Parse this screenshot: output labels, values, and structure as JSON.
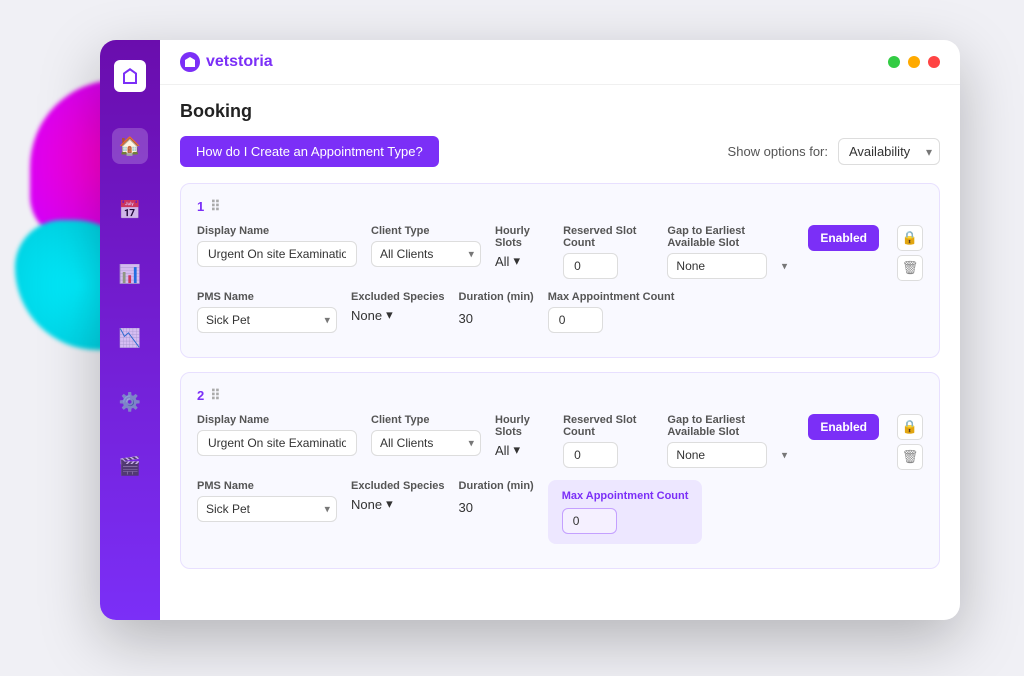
{
  "app": {
    "name": "vetstoria",
    "page_title": "Booking"
  },
  "topbar": {
    "help_button": "How do I Create an Appointment Type?",
    "show_options_label": "Show options for:",
    "show_options_value": "Availability"
  },
  "sidebar": {
    "icons": [
      {
        "name": "home-icon",
        "symbol": "⌂",
        "active": true
      },
      {
        "name": "calendar-icon",
        "symbol": "▦",
        "active": false
      },
      {
        "name": "chart-icon",
        "symbol": "📈",
        "active": false
      },
      {
        "name": "bar-chart-icon",
        "symbol": "▐",
        "active": false
      },
      {
        "name": "gear-icon",
        "symbol": "⚙",
        "active": false
      },
      {
        "name": "video-icon",
        "symbol": "▶",
        "active": false
      }
    ]
  },
  "appointment_rows": [
    {
      "number": "1",
      "display_name_label": "Display Name",
      "display_name_value": "Urgent On site Examination",
      "client_type_label": "Client Type",
      "client_type_value": "All Clients",
      "hourly_slots_label": "Hourly Slots",
      "hourly_slots_value": "All",
      "reserved_slot_label": "Reserved Slot Count",
      "reserved_slot_value": "0",
      "gap_label": "Gap to Earliest Available Slot",
      "gap_value": "None",
      "enabled_label": "Enabled",
      "pms_name_label": "PMS Name",
      "pms_name_value": "Sick Pet",
      "excluded_species_label": "Excluded Species",
      "excluded_species_value": "None",
      "duration_label": "Duration (min)",
      "duration_value": "30",
      "max_appt_label": "Max Appointment Count",
      "max_appt_value": "0",
      "highlighted": false
    },
    {
      "number": "2",
      "display_name_label": "Display Name",
      "display_name_value": "Urgent On site Examination",
      "client_type_label": "Client Type",
      "client_type_value": "All Clients",
      "hourly_slots_label": "Hourly Slots",
      "hourly_slots_value": "All",
      "reserved_slot_label": "Reserved Slot Count",
      "reserved_slot_value": "0",
      "gap_label": "Gap to Earliest Available Slot",
      "gap_value": "None",
      "enabled_label": "Enabled",
      "pms_name_label": "PMS Name",
      "pms_name_value": "Sick Pet",
      "excluded_species_label": "Excluded Species",
      "excluded_species_value": "None",
      "duration_label": "Duration (min)",
      "duration_value": "30",
      "max_appt_label": "Max Appointment Count",
      "max_appt_value": "0",
      "highlighted": true
    }
  ],
  "window_controls": {
    "green": "#33cc44",
    "yellow": "#ffaa00",
    "red": "#ff4444"
  }
}
